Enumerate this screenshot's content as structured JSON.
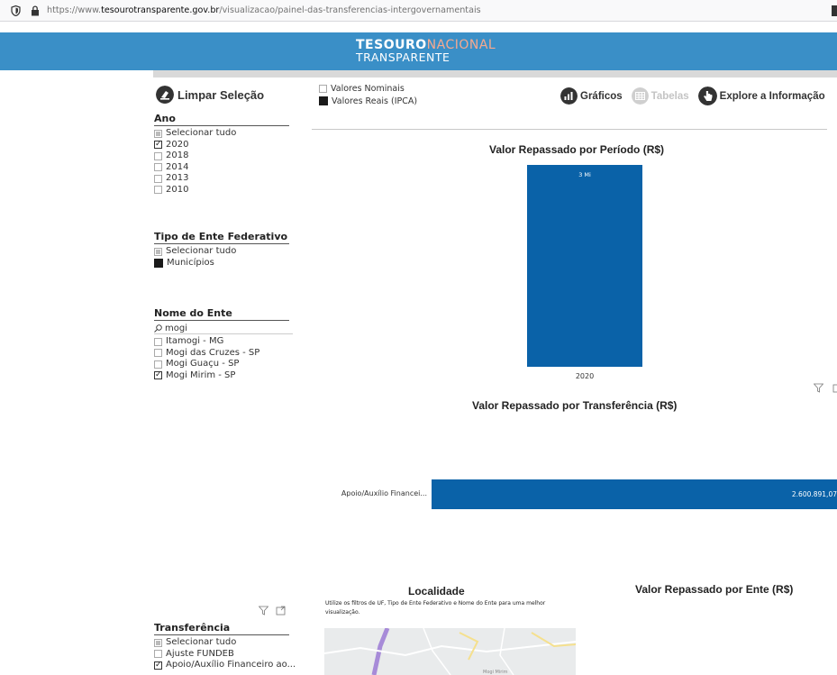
{
  "browser": {
    "url_prefix": "https://www.",
    "url_domain": "tesourotransparente.gov.br",
    "url_path": "/visualizacao/painel-das-transferencias-intergovernamentais"
  },
  "header": {
    "logo_line1_bold": "TESOURO",
    "logo_line1_light": "NACIONAL",
    "logo_line2": "TRANSPARENTE"
  },
  "left_panel": {
    "clear_label": "Limpar Seleção",
    "ano": {
      "title": "Ano",
      "items": [
        {
          "label": "Selecionar tudo",
          "state": "partial"
        },
        {
          "label": "2020",
          "state": "checked"
        },
        {
          "label": "2018",
          "state": "unchecked"
        },
        {
          "label": "2014",
          "state": "unchecked"
        },
        {
          "label": "2013",
          "state": "unchecked"
        },
        {
          "label": "2010",
          "state": "unchecked"
        }
      ]
    },
    "tipo": {
      "title": "Tipo de Ente Federativo",
      "items": [
        {
          "label": "Selecionar tudo",
          "state": "partial"
        },
        {
          "label": "Municípios",
          "state": "filled"
        }
      ]
    },
    "nome": {
      "title": "Nome do Ente",
      "search_value": "mogi",
      "items": [
        {
          "label": "Itamogi - MG",
          "state": "unchecked"
        },
        {
          "label": "Mogi das Cruzes - SP",
          "state": "unchecked"
        },
        {
          "label": "Mogi Guaçu - SP",
          "state": "unchecked"
        },
        {
          "label": "Mogi Mirim - SP",
          "state": "checked"
        }
      ]
    },
    "transferencia": {
      "title": "Transferência",
      "items": [
        {
          "label": "Selecionar tudo",
          "state": "partial"
        },
        {
          "label": "Ajuste FUNDEB",
          "state": "unchecked"
        },
        {
          "label": "Apoio/Auxílio Financeiro ao...",
          "state": "checked"
        }
      ]
    }
  },
  "value_toggle": {
    "nominal": "Valores Nominais",
    "real": "Valores Reais (IPCA)"
  },
  "nav": {
    "graficos": "Gráficos",
    "tabelas": "Tabelas",
    "explore": "Explore a Informação"
  },
  "visuals": {
    "periodo_title": "Valor Repassado por Período (R$)",
    "transferencia_title": "Valor Repassado por Transferência (R$)",
    "localidade_title": "Localidade",
    "localidade_subtitle": "Utilize os filtros de UF, Tipo de Ente Federativo e Nome do Ente para uma melhor visualização.",
    "ente_title": "Valor Repassado por Ente (R$)",
    "map_label": "Mogi Mirim"
  },
  "chart_data": [
    {
      "type": "bar",
      "title": "Valor Repassado por Período (R$)",
      "categories": [
        "2020"
      ],
      "values": [
        2600891.07
      ],
      "data_labels": [
        "3 Mi"
      ]
    },
    {
      "type": "bar",
      "orientation": "horizontal",
      "title": "Valor Repassado por Transferência (R$)",
      "categories": [
        "Apoio/Auxílio Financei..."
      ],
      "values": [
        2600891.07
      ],
      "data_labels": [
        "2.600.891,07"
      ]
    }
  ],
  "colors": {
    "banner": "#3a8fc7",
    "bar": "#0a62a8",
    "logo_accent": "#f6a98f"
  }
}
